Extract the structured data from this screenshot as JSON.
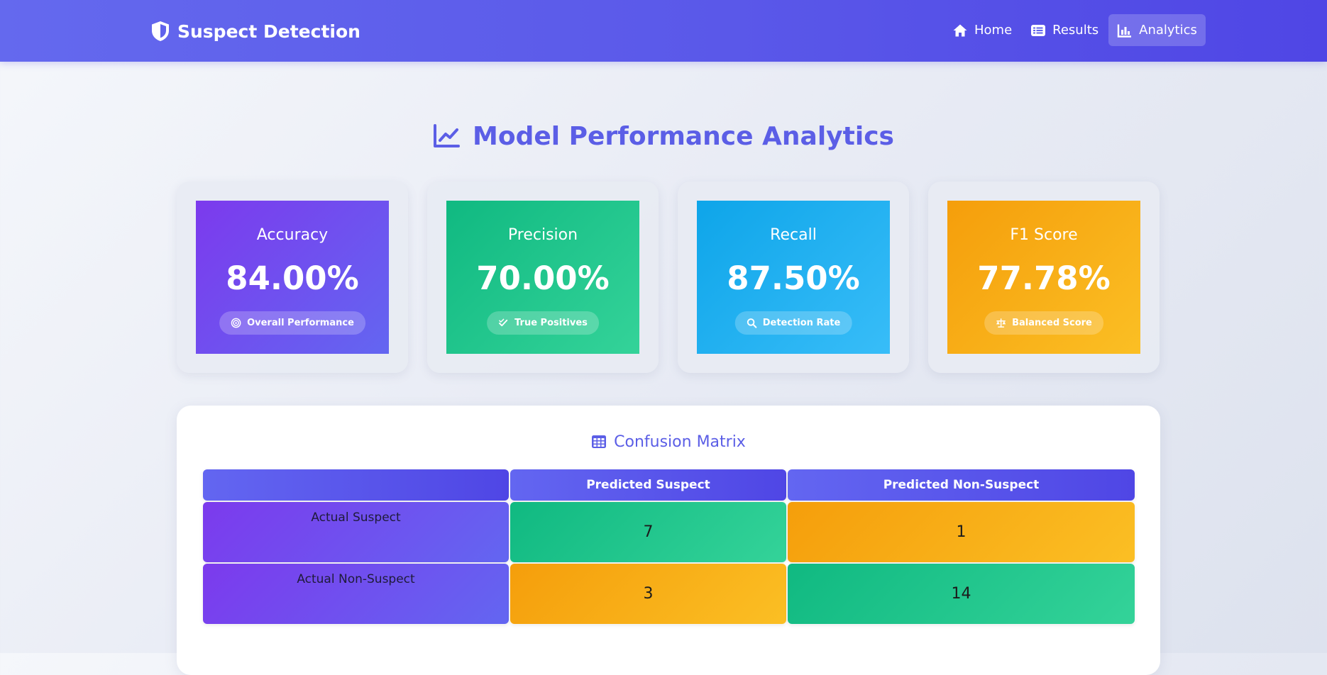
{
  "navbar": {
    "brand": "Suspect Detection",
    "items": [
      {
        "label": "Home",
        "icon": "home-icon",
        "active": false
      },
      {
        "label": "Results",
        "icon": "list-icon",
        "active": false
      },
      {
        "label": "Analytics",
        "icon": "bar-chart-icon",
        "active": true
      }
    ]
  },
  "page": {
    "title": "Model Performance Analytics",
    "title_icon": "line-chart-icon"
  },
  "metrics": [
    {
      "label": "Accuracy",
      "value": "84.00%",
      "badge": "Overall Performance",
      "badge_icon": "target-icon",
      "color_from": "#7c3aed",
      "color_to": "#6366f1"
    },
    {
      "label": "Precision",
      "value": "70.00%",
      "badge": "True Positives",
      "badge_icon": "double-check-icon",
      "color_from": "#10b981",
      "color_to": "#34d399"
    },
    {
      "label": "Recall",
      "value": "87.50%",
      "badge": "Detection Rate",
      "badge_icon": "search-icon",
      "color_from": "#0ea5e9",
      "color_to": "#38bdf8"
    },
    {
      "label": "F1 Score",
      "value": "77.78%",
      "badge": "Balanced Score",
      "badge_icon": "balance-scale-icon",
      "color_from": "#f59e0b",
      "color_to": "#fbbf24"
    }
  ],
  "confusion_matrix": {
    "title": "Confusion Matrix",
    "title_icon": "table-icon",
    "col_headers": [
      "",
      "Predicted Suspect",
      "Predicted Non-Suspect"
    ],
    "rows": [
      {
        "label": "Actual Suspect",
        "values": [
          "7",
          "1"
        ]
      },
      {
        "label": "Actual Non-Suspect",
        "values": [
          "3",
          "14"
        ]
      }
    ]
  },
  "colors": {
    "accent": "#5b5ee6",
    "navbar": "#5a58e9",
    "correct": "#10b981",
    "error": "#f59e0b"
  }
}
